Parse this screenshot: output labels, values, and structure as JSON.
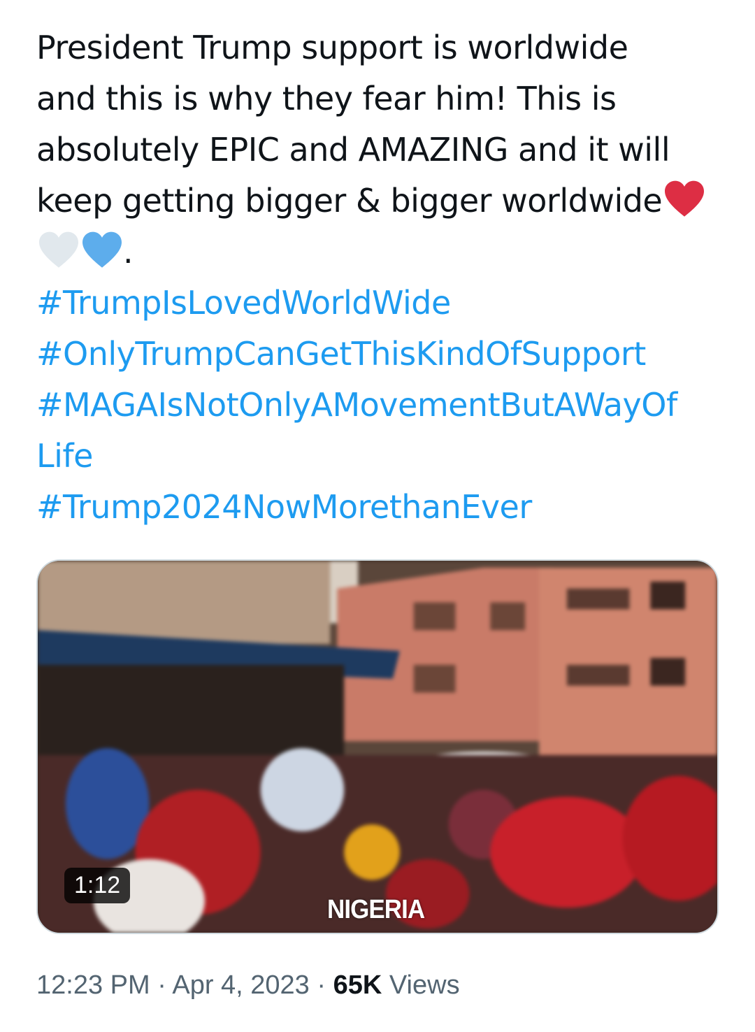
{
  "tweet": {
    "text_lines": [
      "President Trump support is worldwide",
      "and this is why they fear him! This is",
      "absolutely EPIC and AMAZING and it will",
      "keep getting bigger & bigger worldwide"
    ],
    "trailing_punct": ".",
    "hearts": [
      {
        "icon": "red-heart-icon",
        "color": "#dd2e44"
      },
      {
        "icon": "white-heart-icon",
        "color": "#e1e8ed"
      },
      {
        "icon": "blue-heart-icon",
        "color": "#5dadec"
      }
    ],
    "hashtags": [
      "#TrumpIsLovedWorldWide",
      "#OnlyTrumpCanGetThisKindOfSupport",
      "#MAGAIsNotOnlyAMovementButAWayOf",
      "Life",
      "#Trump2024NowMorethanEver"
    ]
  },
  "media": {
    "duration": "1:12",
    "caption": "NIGERIA"
  },
  "meta": {
    "time": "12:23 PM",
    "separator": "·",
    "date": "Apr 4, 2023",
    "views_count": "65K",
    "views_label": "Views"
  },
  "colors": {
    "link": "#1d9bf0",
    "text": "#0f1419",
    "secondary": "#536471"
  }
}
